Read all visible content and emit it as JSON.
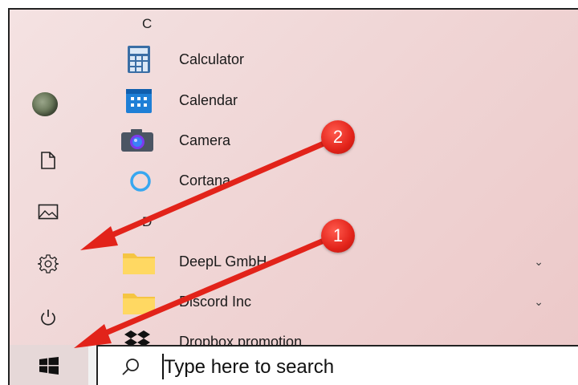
{
  "start_menu": {
    "rail": [
      {
        "name": "user",
        "icon": "user-avatar"
      },
      {
        "name": "documents",
        "icon": "document-icon"
      },
      {
        "name": "pictures",
        "icon": "picture-icon"
      },
      {
        "name": "settings",
        "icon": "gear-icon"
      },
      {
        "name": "power",
        "icon": "power-icon"
      }
    ],
    "apps": {
      "group_c": "C",
      "calculator": "Calculator",
      "calendar": "Calendar",
      "camera": "Camera",
      "cortana": "Cortana",
      "group_d": "D",
      "deepl": "DeepL GmbH",
      "discord": "Discord Inc",
      "dropbox": "Dropbox promotion"
    }
  },
  "taskbar": {
    "search_placeholder": "Type here to search"
  },
  "annotations": {
    "badge_1": "1",
    "badge_2": "2",
    "color": "#e2231a"
  }
}
